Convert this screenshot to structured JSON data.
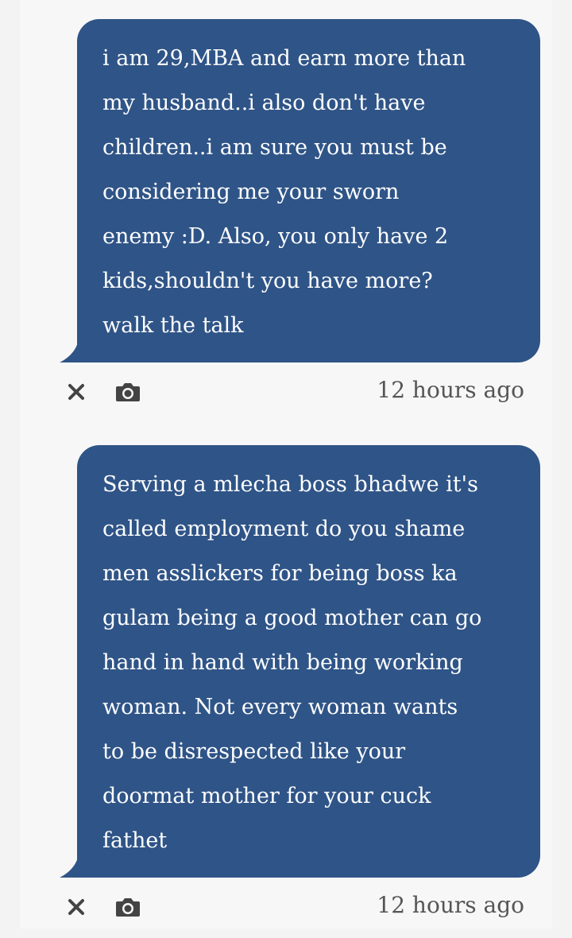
{
  "messages": [
    {
      "text": "i am 29,MBA and earn more than\nmy husband..i also don't have\nchildren..i am sure you must be\nconsidering me your sworn\nenemy :D. Also, you only have 2\nkids,shouldn't you have more?\nwalk the talk",
      "timestamp": "12 hours ago",
      "actions": {
        "dismiss_icon": "close-icon",
        "capture_icon": "camera-icon"
      }
    },
    {
      "text": "Serving a mlecha boss bhadwe it's\ncalled employment do you shame\nmen asslickers for being boss ka\ngulam being a good mother can go\nhand in hand with being working\nwoman. Not every woman wants\nto be disrespected like your\ndoormat mother for your cuck\nfathet",
      "timestamp": "12 hours ago",
      "actions": {
        "dismiss_icon": "close-icon",
        "capture_icon": "camera-icon"
      }
    }
  ],
  "colors": {
    "bubble": "#2f5487",
    "bubble_text": "#ffffff",
    "background": "#f3f3f3",
    "timestamp": "#555555",
    "icon": "#444444"
  }
}
